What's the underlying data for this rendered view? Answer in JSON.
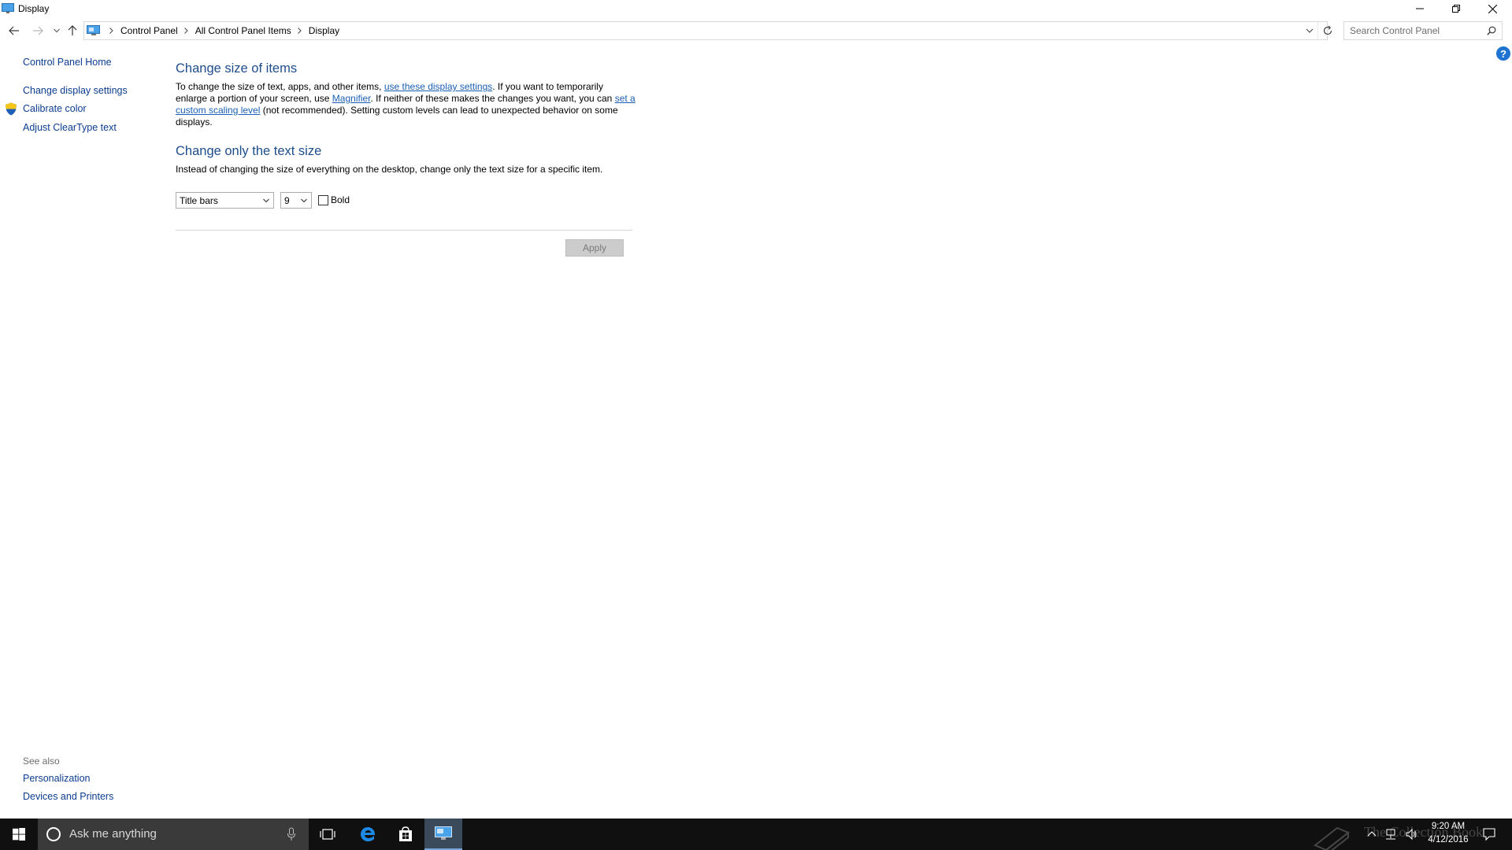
{
  "window": {
    "title": "Display"
  },
  "address": {
    "crumbs": [
      "Control Panel",
      "All Control Panel Items",
      "Display"
    ]
  },
  "search": {
    "placeholder": "Search Control Panel"
  },
  "left_pane": {
    "home": "Control Panel Home",
    "links": [
      "Change display settings",
      "Calibrate color",
      "Adjust ClearType text"
    ],
    "see_also_title": "See also",
    "see_also": [
      "Personalization",
      "Devices and Printers"
    ]
  },
  "section1": {
    "title": "Change size of items",
    "text_a": "To change the size of text, apps, and other items, ",
    "link_a": "use these display settings",
    "text_b": ".  If you want to temporarily enlarge a portion of your screen, use ",
    "link_b": "Magnifier",
    "text_c": ".  If neither of these makes the changes you want, you can ",
    "link_c": "set a custom scaling level",
    "text_d": " (not recommended).  Setting custom levels can lead to unexpected behavior on some displays."
  },
  "section2": {
    "title": "Change only the text size",
    "text": "Instead of changing the size of everything on the desktop, change only the text size for a specific item.",
    "item_select": "Title bars",
    "size_select": "9",
    "bold_label": "Bold",
    "bold_checked": false,
    "apply_label": "Apply"
  },
  "taskbar": {
    "search_text": "Ask me anything",
    "time": "9:20 AM",
    "date": "4/12/2016"
  },
  "colors": {
    "heading": "#1e4d8c",
    "link": "#1a5fb4",
    "nav_link": "#0b3c8f",
    "taskbar": "#101010"
  }
}
